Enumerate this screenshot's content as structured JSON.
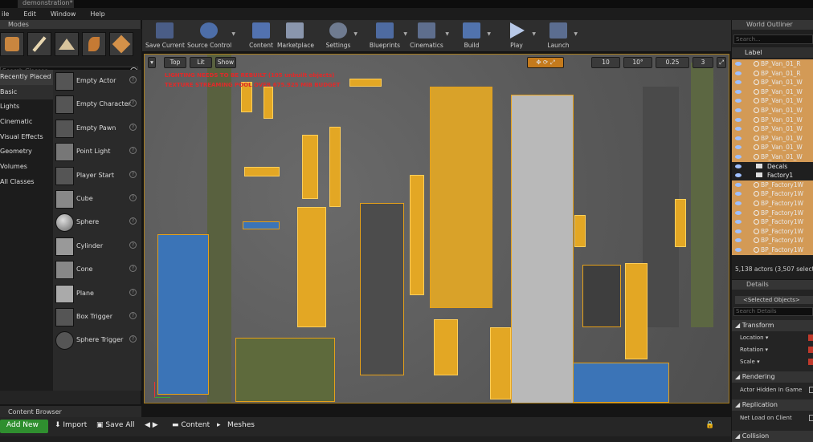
{
  "window": {
    "tab_title": "demonstration*"
  },
  "menu": [
    "ile",
    "Edit",
    "Window",
    "Help"
  ],
  "modes": {
    "panel_title": "Modes",
    "search_placeholder": "Search Classes",
    "categories": [
      "Recently Placed",
      "Basic",
      "Lights",
      "Cinematic",
      "Visual Effects",
      "Geometry",
      "Volumes",
      "All Classes"
    ],
    "items": [
      "Empty Actor",
      "Empty Character",
      "Empty Pawn",
      "Point Light",
      "Player Start",
      "Cube",
      "Sphere",
      "Cylinder",
      "Cone",
      "Plane",
      "Box Trigger",
      "Sphere Trigger"
    ]
  },
  "toolbar": {
    "buttons": [
      "Save Current",
      "Source Control",
      "Content",
      "Marketplace",
      "Settings",
      "Blueprints",
      "Cinematics",
      "Build",
      "Play",
      "Launch"
    ]
  },
  "viewport": {
    "view_mode": "Top",
    "lit_mode": "Lit",
    "show_label": "Show",
    "grid_snap": "10",
    "rot_snap": "10°",
    "scale_snap": "0.25",
    "cam_speed": "3",
    "warnings": [
      "LIGHTING NEEDS TO BE REBUILT (105 unbuilt objects)",
      "TEXTURE STREAMING POOL OVER 675.925 MiB BUDGET"
    ]
  },
  "outliner": {
    "panel_title": "World Outliner",
    "search_placeholder": "Search...",
    "column_label": "Label",
    "rows": [
      {
        "label": "BP_Van_01_R",
        "type": "actor"
      },
      {
        "label": "BP_Van_01_R",
        "type": "actor"
      },
      {
        "label": "BP_Van_01_W",
        "type": "actor"
      },
      {
        "label": "BP_Van_01_W",
        "type": "actor"
      },
      {
        "label": "BP_Van_01_W",
        "type": "actor"
      },
      {
        "label": "BP_Van_01_W",
        "type": "actor"
      },
      {
        "label": "BP_Van_01_W",
        "type": "actor"
      },
      {
        "label": "BP_Van_01_W",
        "type": "actor"
      },
      {
        "label": "BP_Van_01_W",
        "type": "actor"
      },
      {
        "label": "BP_Van_01_W",
        "type": "actor"
      },
      {
        "label": "BP_Van_01_W",
        "type": "actor"
      },
      {
        "label": "Decals",
        "type": "folder"
      },
      {
        "label": "Factory1",
        "type": "folder"
      },
      {
        "label": "BP_Factory1W",
        "type": "actor"
      },
      {
        "label": "BP_Factory1W",
        "type": "actor"
      },
      {
        "label": "BP_Factory1W",
        "type": "actor"
      },
      {
        "label": "BP_Factory1W",
        "type": "actor"
      },
      {
        "label": "BP_Factory1W",
        "type": "actor"
      },
      {
        "label": "BP_Factory1W",
        "type": "actor"
      },
      {
        "label": "BP_Factory1W",
        "type": "actor"
      },
      {
        "label": "BP_Factory1W",
        "type": "actor"
      }
    ],
    "count": "5,138 actors (3,507 selected)"
  },
  "details": {
    "panel_title": "Details",
    "selected": "<Selected Objects>",
    "search_placeholder": "Search Details",
    "sections": [
      "Transform",
      "Rendering",
      "Replication",
      "Collision"
    ],
    "transform_rows": [
      "Location",
      "Rotation",
      "Scale"
    ],
    "rendering_row": "Actor Hidden In Game",
    "replication_row": "Net Load on Client"
  },
  "content_browser": {
    "tab_title": "Content Browser",
    "add_new": "Add New",
    "import": "Import",
    "save_all": "Save All",
    "path": [
      "Content",
      "Meshes"
    ]
  }
}
